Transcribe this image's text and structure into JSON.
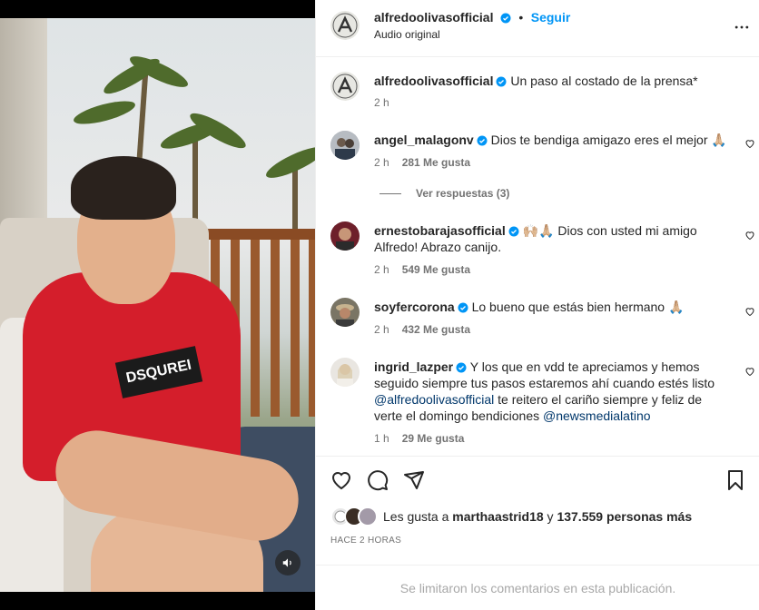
{
  "post": {
    "author": "alfredoolivasofficial",
    "follow_label": "Seguir",
    "separator": "•",
    "audio_label": "Audio original",
    "more_icon": "more-horizontal-icon",
    "caption": "Un paso al costado de la prensa*",
    "caption_time": "2 h"
  },
  "video": {
    "shirt_text": "DSQUREI",
    "mute_icon": "speaker-icon"
  },
  "comments": [
    {
      "user": "angel_malagonv",
      "text": "Dios te bendiga amigazo eres el mejor 🙏🏼",
      "time": "2 h",
      "likes": "281 Me gusta"
    },
    {
      "user": "ernestobarajasofficial",
      "text_line1": "🙌🏼🙏🏼 Dios con usted mi amigo",
      "text_line2": "Alfredo! Abrazo canijo.",
      "time": "2 h",
      "likes": "549 Me gusta"
    },
    {
      "user": "soyfercorona",
      "text": "Lo bueno que estás bien hermano 🙏🏼",
      "time": "2 h",
      "likes": "432 Me gusta"
    },
    {
      "user": "ingrid_lazper",
      "line1": "Y los que en vdd te apreciamos y hemos",
      "line2": "seguido siempre tus pasos estaremos ahí cuando estés listo",
      "mention1": "@alfredoolivasofficial",
      "line3_rest": " te reitero el cariño siempre y feliz de",
      "line4_start": "verte el domingo bendiciones ",
      "mention2": "@newsmedialatino",
      "time": "1 h",
      "likes": "29 Me gusta"
    }
  ],
  "view_replies": "Ver respuestas (3)",
  "likes_summary": {
    "prefix": "Les gusta a ",
    "user": "marthaastrid18",
    "middle": " y ",
    "count": "137.559 personas más"
  },
  "timestamp": "HACE 2 HORAS",
  "comments_limited": "Se limitaron los comentarios en esta publicación.",
  "colors": {
    "verified": "#0095f6",
    "link": "#00376b",
    "follow": "#0095f6",
    "muted": "#737373"
  }
}
